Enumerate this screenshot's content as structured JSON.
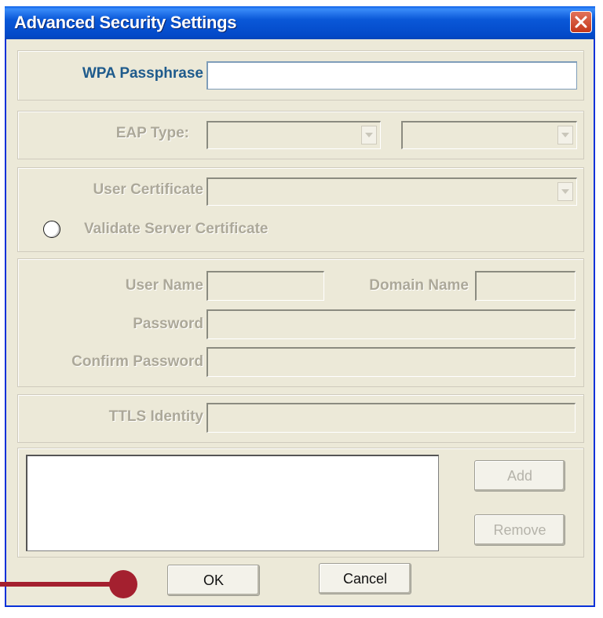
{
  "window": {
    "title": "Advanced Security Settings"
  },
  "wpa": {
    "label": "WPA Passphrase",
    "value": ""
  },
  "eap": {
    "label": "EAP Type:",
    "type_value": "",
    "inner_value": ""
  },
  "certificate": {
    "user_cert_label": "User Certificate",
    "user_cert_value": "",
    "validate_label": "Validate Server Certificate"
  },
  "credentials": {
    "user_name_label": "User Name",
    "user_name_value": "",
    "domain_name_label": "Domain Name",
    "domain_name_value": "",
    "password_label": "Password",
    "password_value": "",
    "confirm_password_label": "Confirm Password",
    "confirm_password_value": ""
  },
  "ttls": {
    "label": "TTLS Identity",
    "value": ""
  },
  "list": {
    "items": [],
    "add_label": "Add",
    "remove_label": "Remove"
  },
  "footer": {
    "ok_label": "OK",
    "cancel_label": "Cancel"
  },
  "colors": {
    "title_bar": "#0a58d8",
    "active_label": "#1f5b8c",
    "disabled_label": "#aca899",
    "pointer": "#a4202f"
  }
}
